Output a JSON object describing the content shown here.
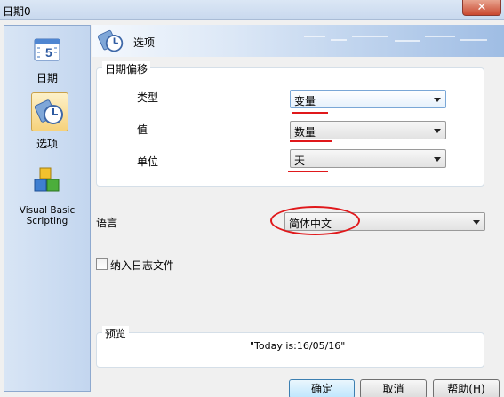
{
  "window": {
    "title": "日期0",
    "close_glyph": "✕"
  },
  "sidebar": {
    "items": [
      {
        "label": "日期",
        "icon": "calendar-icon"
      },
      {
        "label": "选项",
        "icon": "options-clock-icon",
        "selected": true
      },
      {
        "label": "Visual Basic Scripting",
        "icon": "vbscript-blocks-icon"
      }
    ]
  },
  "header": {
    "title": "选项",
    "icon": "options-clock-icon"
  },
  "offset_group": {
    "title": "日期偏移",
    "fields": [
      {
        "label": "类型",
        "value": "变量"
      },
      {
        "label": "值",
        "value": "数量"
      },
      {
        "label": "单位",
        "value": "天"
      }
    ]
  },
  "language": {
    "label": "语言",
    "value": "简体中文"
  },
  "log_checkbox": {
    "label": "纳入日志文件",
    "checked": false
  },
  "preview": {
    "title": "预览",
    "text": "\"Today is:16/05/16\""
  },
  "buttons": {
    "ok": "确定",
    "cancel": "取消",
    "help": "帮助(H)"
  },
  "annotation_color": "#e0181b",
  "accent_color": "#9fbde4"
}
